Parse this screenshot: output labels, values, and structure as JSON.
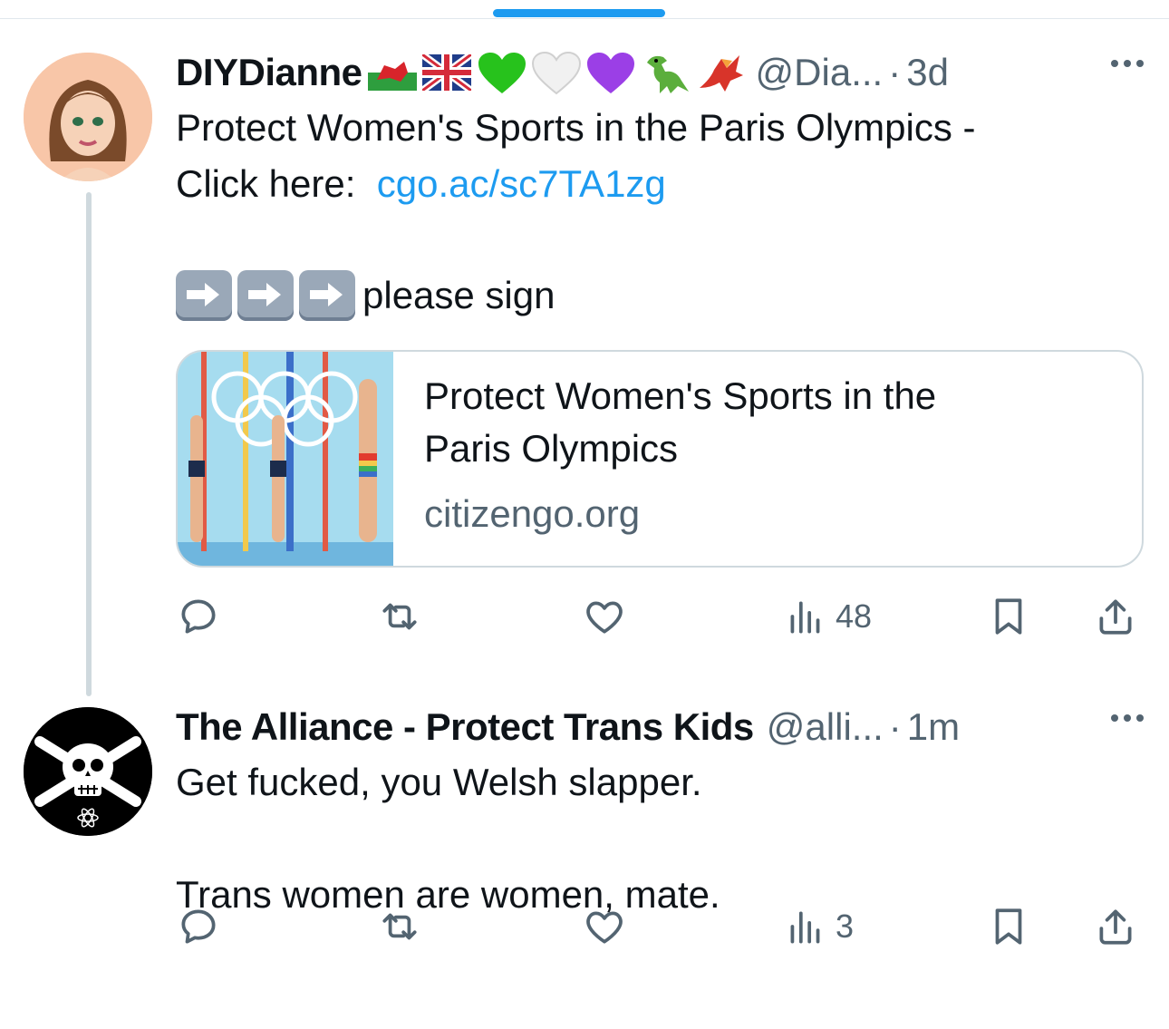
{
  "colors": {
    "link": "#1d9bf0",
    "secondary": "#536471",
    "text": "#0f1419",
    "border": "#cfd9de"
  },
  "tweets": [
    {
      "display_name": "DIYDianne",
      "name_emojis": [
        "wales-flag-icon",
        "uk-flag-icon",
        "green-heart-icon",
        "white-heart-icon",
        "purple-heart-icon",
        "t-rex-icon",
        "dragon-icon"
      ],
      "handle": "@Dia...",
      "dot": "·",
      "time": "3d",
      "text_line1": "Protect Women's Sports in the Paris Olympics -",
      "text_line2_prefix": "Click here:",
      "link": "cgo.ac/sc7TA1zg",
      "arrow_text": "please sign",
      "card": {
        "title_line1": "Protect Women's Sports in the",
        "title_line2": "Paris Olympics",
        "domain": "citizengo.org"
      },
      "actions": {
        "views": "48"
      }
    },
    {
      "display_name": "The Alliance - Protect Trans Kids",
      "handle": "@alli...",
      "dot": "·",
      "time": "1m",
      "text_line1": "Get fucked, you Welsh slapper.",
      "text_line2": "Trans women are women, mate.",
      "actions": {
        "views": "3"
      }
    }
  ]
}
